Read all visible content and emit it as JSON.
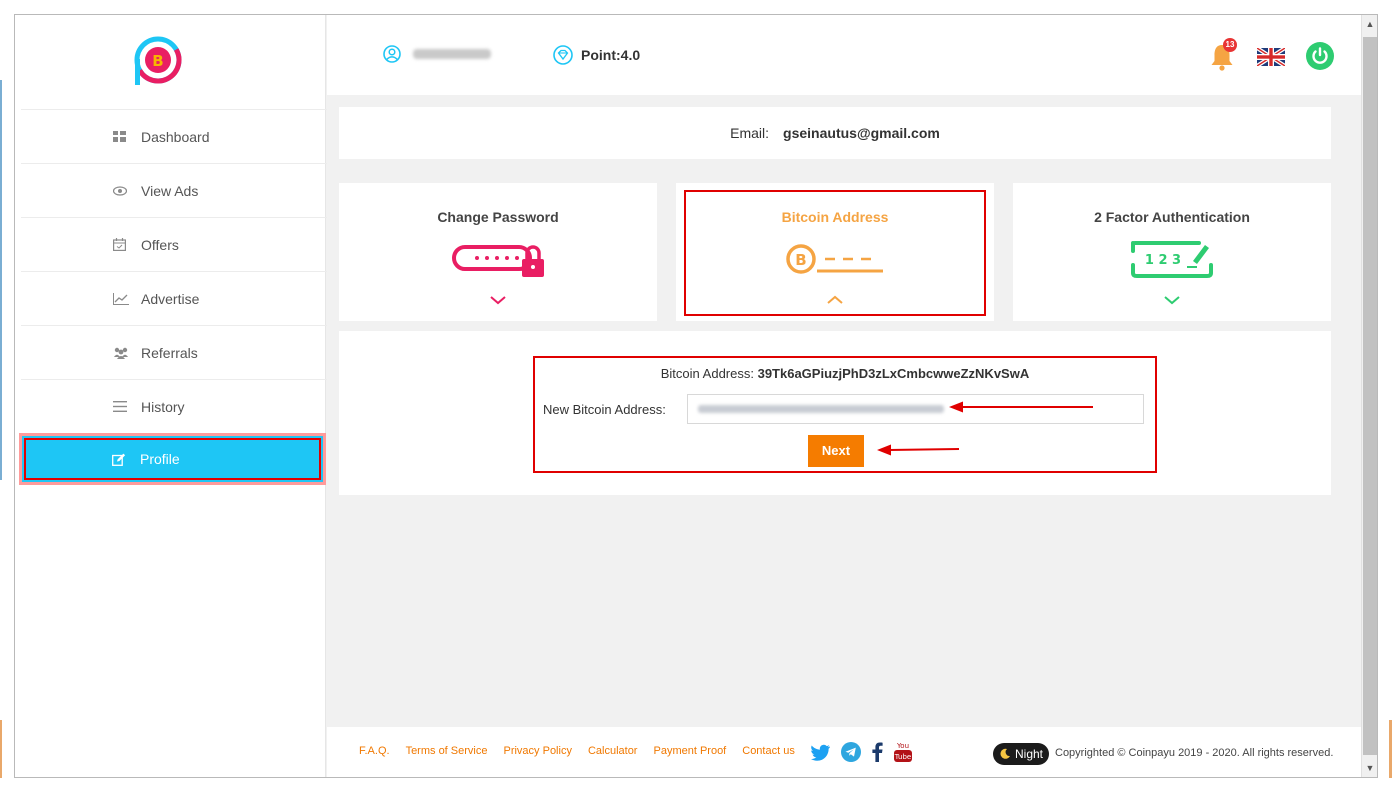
{
  "sidebar": {
    "items": [
      {
        "label": "Dashboard",
        "icon": "grid-icon"
      },
      {
        "label": "View Ads",
        "icon": "eye-icon"
      },
      {
        "label": "Offers",
        "icon": "calendar-icon"
      },
      {
        "label": "Advertise",
        "icon": "chart-icon"
      },
      {
        "label": "Referrals",
        "icon": "users-icon"
      },
      {
        "label": "History",
        "icon": "menu-icon"
      },
      {
        "label": "Profile",
        "icon": "edit-icon"
      }
    ],
    "active": "Profile"
  },
  "topbar": {
    "points_label": "Point:4.0",
    "notification_count": "13"
  },
  "email": {
    "label": "Email:",
    "value": "gseinautus@gmail.com"
  },
  "tiles": [
    {
      "title": "Change Password",
      "color": "#e91e63"
    },
    {
      "title": "Bitcoin Address",
      "color": "#f5a443"
    },
    {
      "title": "2 Factor Authentication",
      "color": "#2ecc71"
    }
  ],
  "twofa_digits": "1 2 3",
  "bitcoin": {
    "current_label": "Bitcoin Address:",
    "current_value": "39Tk6aGPiuzjPhD3zLxCmbcwweZzNKvSwA",
    "new_label": "New Bitcoin Address:",
    "next_label": "Next"
  },
  "footer": {
    "links": [
      "F.A.Q.",
      "Terms of Service",
      "Privacy Policy",
      "Calculator",
      "Payment Proof",
      "Contact us"
    ],
    "night_label": "Night",
    "copyright": "Copyrighted © Coinpayu 2019 - 2020. All rights reserved."
  },
  "colors": {
    "accent": "#1ec6f5",
    "orange": "#f57c00",
    "highlight": "#e00000"
  }
}
